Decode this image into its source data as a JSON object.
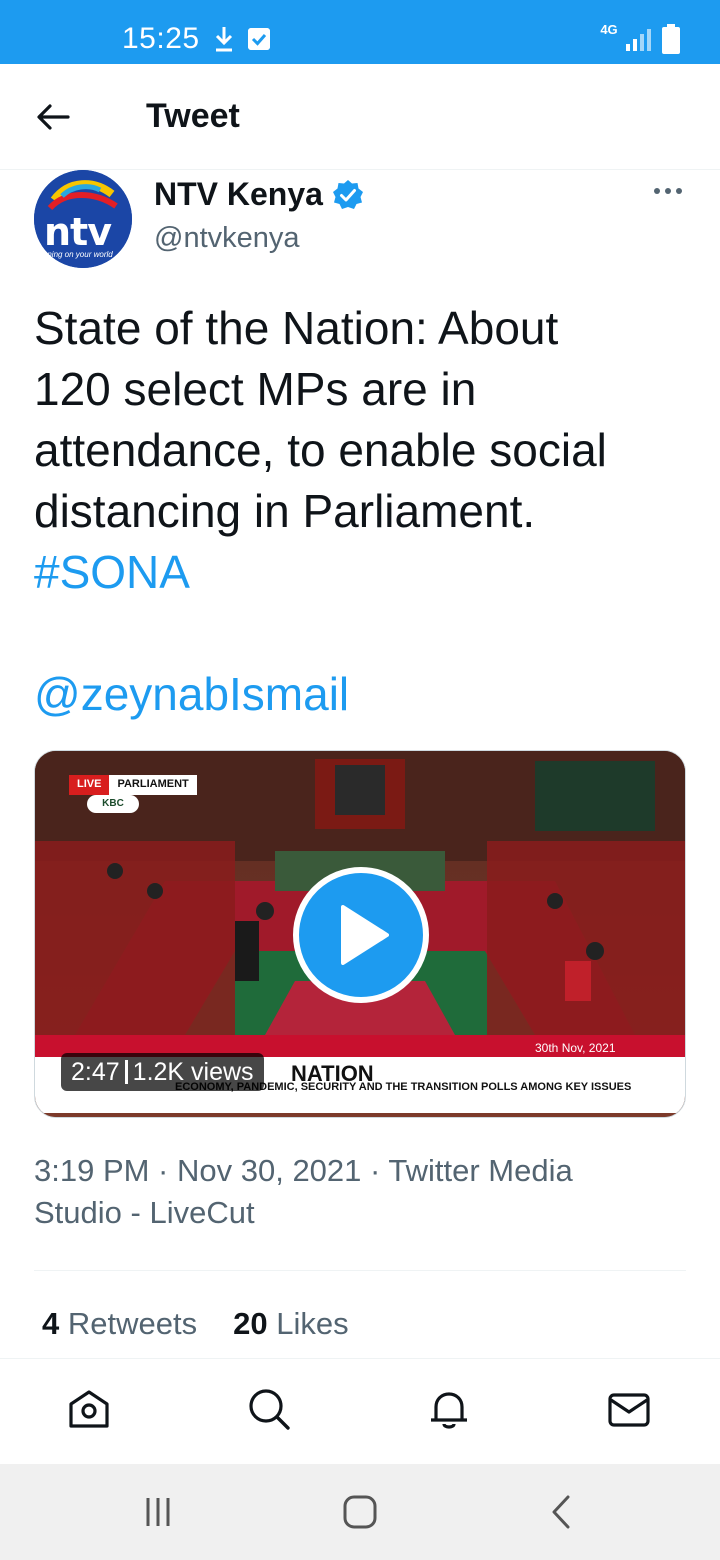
{
  "status_bar": {
    "time": "15:25",
    "network": "4G",
    "icons": [
      "download-icon",
      "check-box-icon",
      "signal-icon",
      "battery-icon"
    ]
  },
  "header": {
    "title": "Tweet",
    "back_icon": "arrow-left-icon"
  },
  "tweet": {
    "author": {
      "name": "NTV Kenya",
      "handle": "@ntvkenya",
      "verified": true,
      "avatar_text": "ntv",
      "avatar_tagline": "turning on your world"
    },
    "text_lines": [
      "State of the Nation: About",
      "120 select MPs are in",
      "attendance, to enable social",
      "distancing in Parliament."
    ],
    "hashtag": "#SONA",
    "mention": "@zeynabIsmail",
    "media": {
      "live_label": "LIVE",
      "channel_label": "PARLIAMENT",
      "broadcaster_logo": "KBC",
      "ticker_date": "30th Nov, 2021",
      "ticker_headline": "NATION",
      "ticker_sub": "ECONOMY, PANDEMIC, SECURITY AND THE TRANSITION POLLS AMONG KEY ISSUES",
      "duration": "2:47",
      "views": "1.2K views"
    },
    "timestamp_line1": "3:19 PM · Nov 30, 2021 · Twitter Media",
    "timestamp_line2": "Studio - LiveCut",
    "retweets_count": "4",
    "retweets_label": "Retweets",
    "likes_count": "20",
    "likes_label": "Likes"
  },
  "tabbar": {
    "tabs": [
      "home-icon",
      "search-icon",
      "notifications-bell-icon",
      "messages-envelope-icon"
    ]
  },
  "colors": {
    "accent": "#1d9bf0",
    "text": "#0f1419",
    "secondary": "#536471"
  }
}
